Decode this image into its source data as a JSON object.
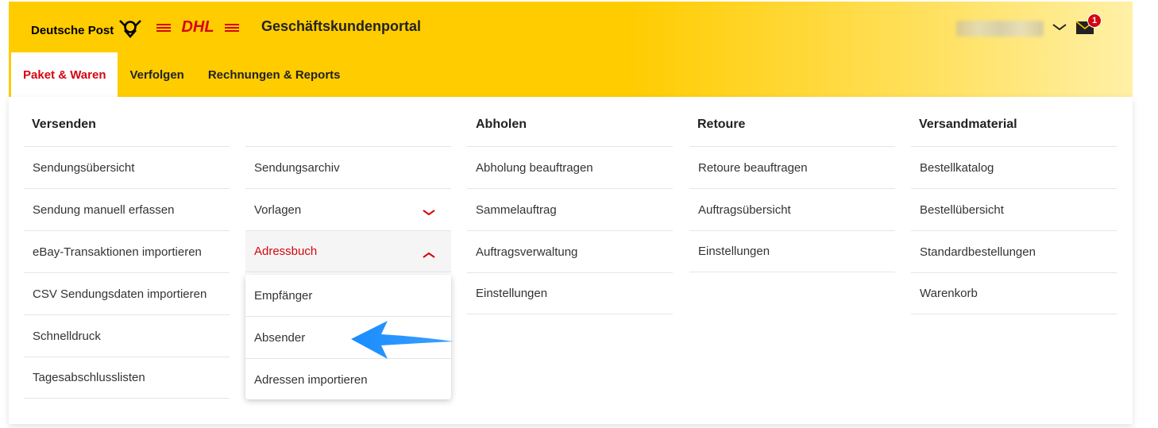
{
  "header": {
    "brand_post": "Deutsche Post",
    "brand_dhl": "DHL",
    "portal_title": "Geschäftskundenportal",
    "mail_badge_count": "1",
    "colors": {
      "yellow": "#ffcc00",
      "red": "#d40511"
    }
  },
  "tabs": [
    {
      "label": "Paket & Waren",
      "active": true
    },
    {
      "label": "Verfolgen",
      "active": false
    },
    {
      "label": "Rechnungen & Reports",
      "active": false
    }
  ],
  "menu": {
    "versenden": {
      "title": "Versenden",
      "col1": [
        "Sendungsübersicht",
        "Sendung manuell erfassen",
        "eBay-Transaktionen importieren",
        "CSV Sendungsdaten importieren",
        "Schnelldruck",
        "Tagesabschlusslisten"
      ],
      "col2": [
        "Sendungsarchiv",
        "Vorlagen",
        "Adressbuch"
      ],
      "adressbuch_sub": [
        "Empfänger",
        "Absender",
        "Adressen importieren"
      ]
    },
    "abholen": {
      "title": "Abholen",
      "items": [
        "Abholung beauftragen",
        "Sammelauftrag",
        "Auftragsverwaltung",
        "Einstellungen"
      ]
    },
    "retoure": {
      "title": "Retoure",
      "items": [
        "Retoure beauftragen",
        "Auftragsübersicht",
        "Einstellungen"
      ]
    },
    "versandmaterial": {
      "title": "Versandmaterial",
      "items": [
        "Bestellkatalog",
        "Bestellübersicht",
        "Standardbestellungen",
        "Warenkorb"
      ]
    }
  },
  "icons": {
    "horn": "posthorn-icon",
    "user_chevron": "chevron-down-icon",
    "mail": "envelope-icon",
    "annotation": "arrow-annotation-icon"
  }
}
